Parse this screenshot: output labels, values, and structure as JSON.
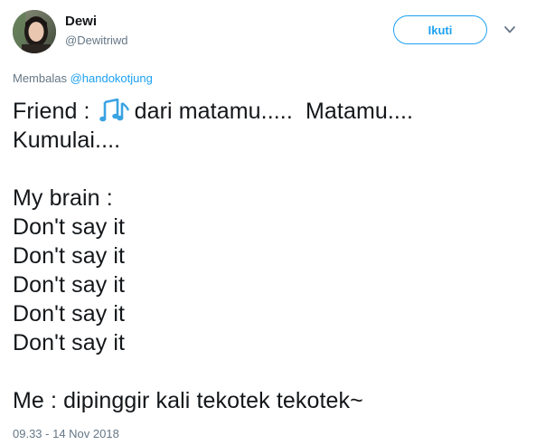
{
  "user": {
    "display_name": "Dewi",
    "handle": "@Dewitriwd",
    "avatar_icon": "profile-photo"
  },
  "follow_button": {
    "label": "Ikuti"
  },
  "menu": {
    "icon": "chevron-down-icon"
  },
  "reply": {
    "prefix": "Membalas ",
    "mention": "@handokotjung"
  },
  "tweet": {
    "line_1_before_emoji": "Friend : ",
    "emoji": "musical-notes-emoji",
    "line_1_after_emoji": "dari matamu.....  Matamu....",
    "lines": [
      "Kumulai....",
      "",
      "My brain :",
      "Don't say it",
      "Don't say it",
      "Don't say it",
      "Don't say it",
      "Don't say it",
      "",
      "Me : dipinggir kali tekotek tekotek~"
    ]
  },
  "timestamp": "09.33 - 14 Nov 2018",
  "colors": {
    "accent": "#1da1f2",
    "text": "#14171a",
    "secondary": "#657786"
  }
}
